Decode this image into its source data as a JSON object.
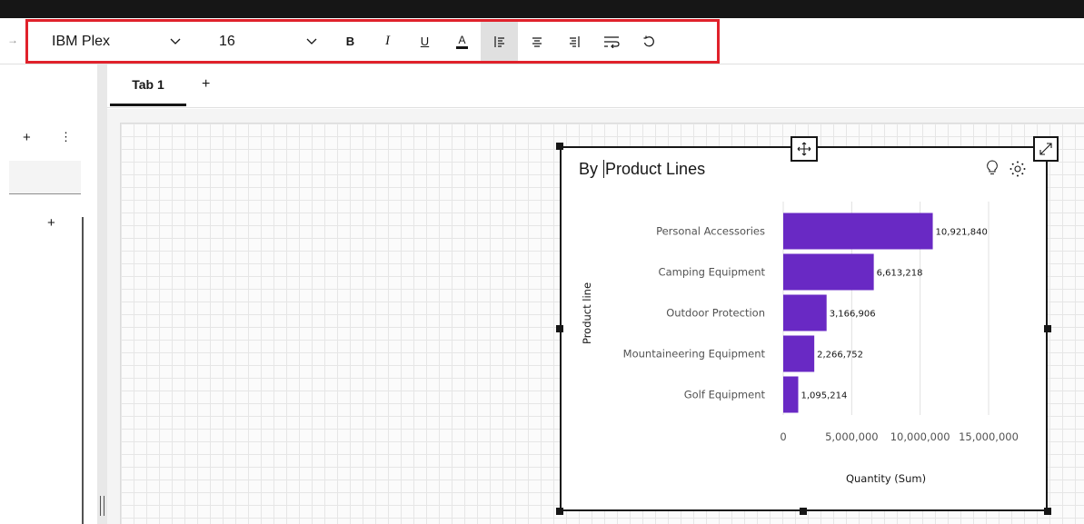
{
  "toolbar": {
    "font_family": "IBM Plex",
    "font_size": "16",
    "bold": "B",
    "italic": "I",
    "underline": "U",
    "font_color": "A",
    "align_left_icon": "align-left-icon",
    "align_center_icon": "align-center-icon",
    "align_right_icon": "align-right-icon",
    "wrap_icon": "text-wrap-icon",
    "reset_icon": "reset-icon",
    "highlight_color": "#e0212b"
  },
  "tabs": [
    {
      "label": "Tab 1",
      "active": true
    }
  ],
  "tab_add": "+",
  "left_panel": {
    "add": "+",
    "more": "⋮",
    "add2": "+"
  },
  "widget": {
    "title_before_cursor": "By ",
    "title_after_cursor": "Product Lines"
  },
  "chart_data": {
    "type": "bar",
    "orientation": "horizontal",
    "categories": [
      "Personal Accessories",
      "Camping Equipment",
      "Outdoor Protection",
      "Mountaineering Equipment",
      "Golf Equipment"
    ],
    "values": [
      10921840,
      6613218,
      3166906,
      2266752,
      1095214
    ],
    "value_labels": [
      "10,921,840",
      "6,613,218",
      "3,166,906",
      "2,266,752",
      "1,095,214"
    ],
    "xlabel": "Quantity (Sum)",
    "ylabel": "Product line",
    "xlim": [
      0,
      15000000
    ],
    "xticks": [
      0,
      5000000,
      10000000,
      15000000
    ],
    "xtick_labels": [
      "0",
      "5,000,000",
      "10,000,000",
      "15,000,000"
    ],
    "bar_color": "#6929c4",
    "grid": true
  }
}
